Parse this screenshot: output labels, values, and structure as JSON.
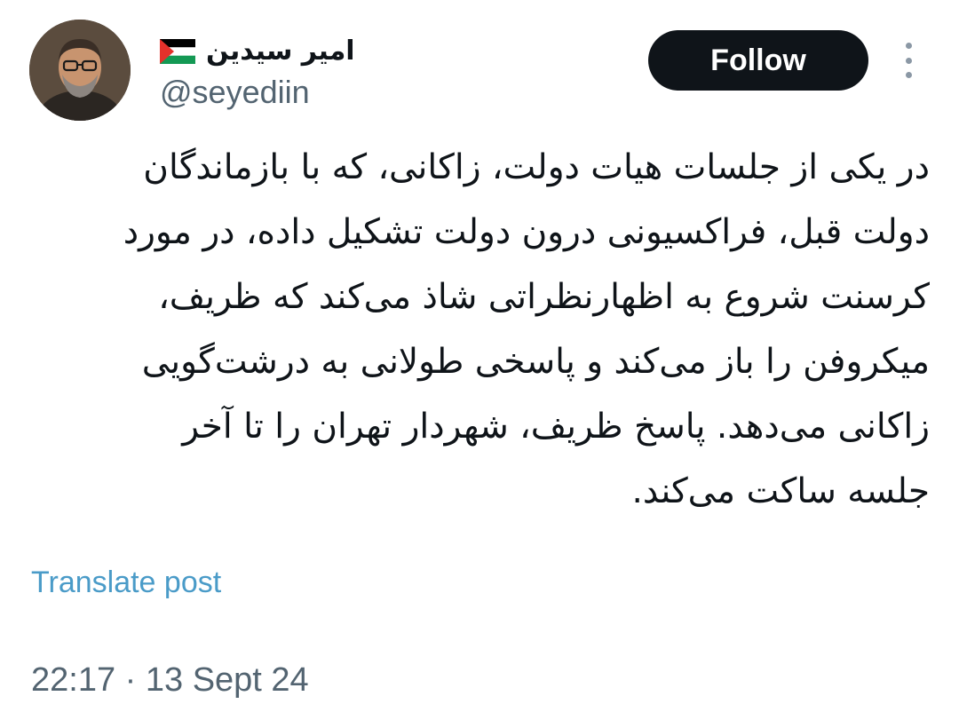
{
  "author": {
    "display_name": "امیر سیدین",
    "flag_icon": "palestine-flag-icon",
    "handle": "@seyediin",
    "avatar_icon": "profile-photo-avatar"
  },
  "actions": {
    "follow_label": "Follow",
    "more_icon": "more-vertical-icon"
  },
  "tweet": {
    "lines": [
      "در یکی از جلسات هیات دولت، زاکانی، که با بازماندگان",
      "دولت قبل، فراکسیونی درون دولت تشکیل داده، در مورد",
      "کرسنت شروع به اظهارنظراتی شاذ می‌کند که ظریف،",
      "میکروفن را باز می‌کند و پاسخی طولانی به درشت‌گویی",
      "زاکانی می‌دهد. پاسخ ظریف، شهردار تهران را تا آخر",
      "جلسه ساکت می‌کند."
    ],
    "translate_label": "Translate post",
    "timestamp": "22:17 · 13 Sept 24"
  },
  "colors": {
    "follow_bg": "#0f1419",
    "link": "#4a9bc8",
    "secondary_text": "#536471"
  }
}
